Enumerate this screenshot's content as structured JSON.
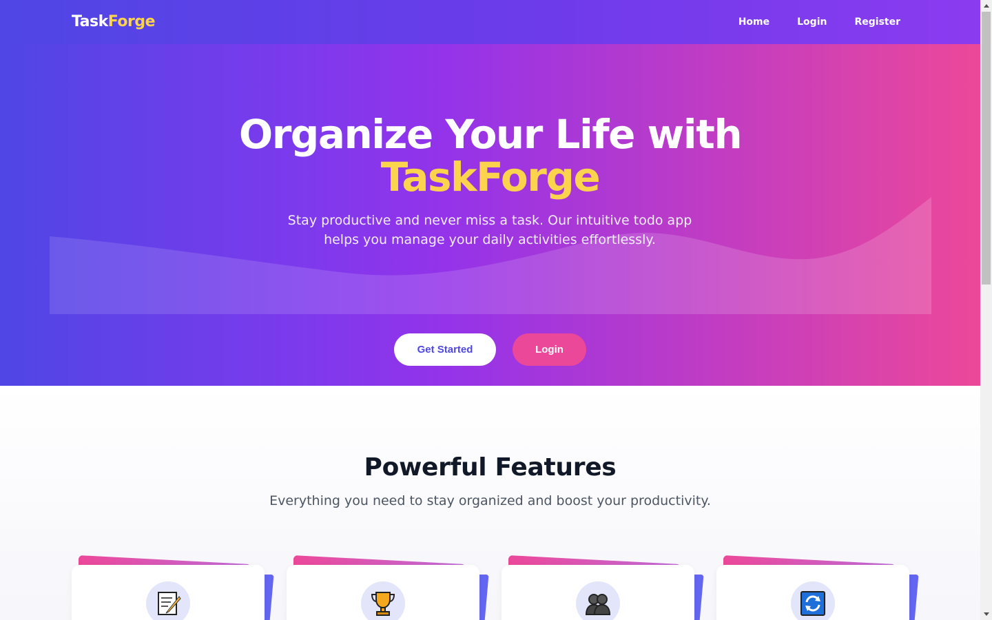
{
  "nav": {
    "logo_main": "Task",
    "logo_accent": "Forge",
    "links": [
      "Home",
      "Login",
      "Register"
    ]
  },
  "hero": {
    "title_line1": "Organize Your Life with",
    "title_line2": "TaskForge",
    "subtitle": "Stay productive and never miss a task. Our intuitive todo app helps you manage your daily activities effortlessly.",
    "primary_button": "Get Started",
    "secondary_button": "Login"
  },
  "features": {
    "title": "Powerful Features",
    "subtitle": "Everything you need to stay organized and boost your productivity.",
    "cards": [
      {
        "icon": "memo-icon"
      },
      {
        "icon": "trophy-icon"
      },
      {
        "icon": "people-icon"
      },
      {
        "icon": "refresh-icon"
      }
    ]
  },
  "colors": {
    "brand_indigo": "#4f46e5",
    "brand_purple": "#9333ea",
    "brand_pink": "#ec4899",
    "accent_yellow": "#fcd34d"
  }
}
